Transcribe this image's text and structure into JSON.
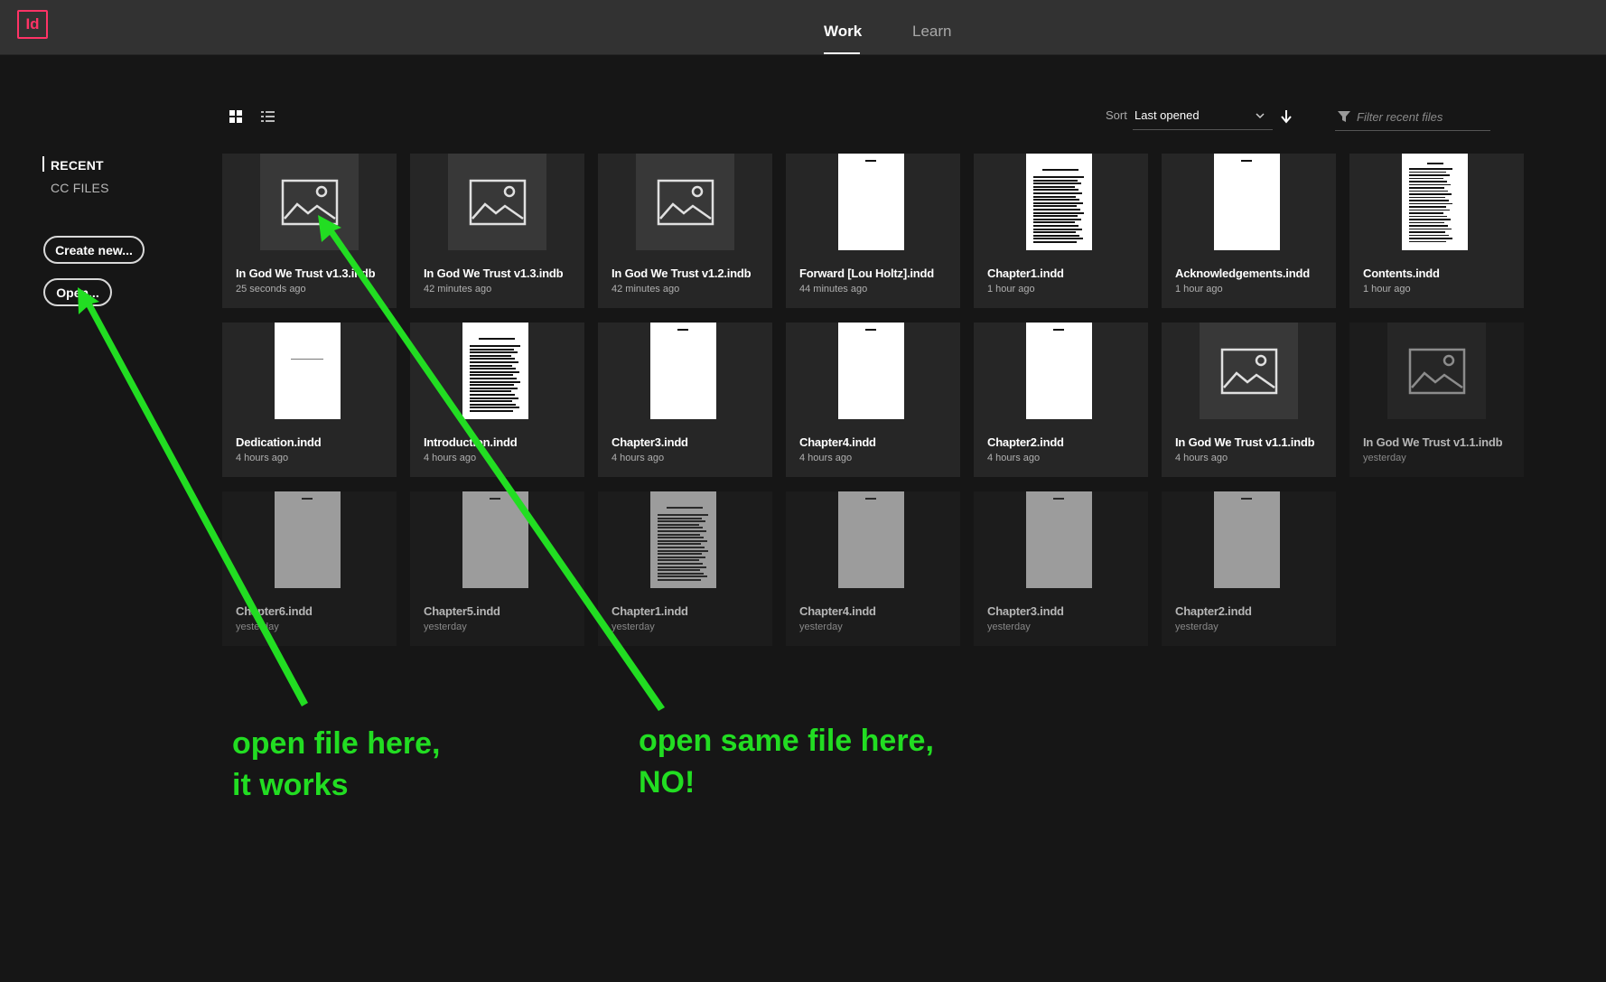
{
  "header": {
    "logo": "Id",
    "tabs": [
      {
        "label": "Work",
        "active": true
      },
      {
        "label": "Learn",
        "active": false
      }
    ]
  },
  "sidebar": {
    "items": [
      {
        "label": "RECENT",
        "active": true
      },
      {
        "label": "CC FILES",
        "active": false
      }
    ],
    "create_button": "Create new...",
    "open_button": "Open..."
  },
  "toolbar": {
    "sort_label": "Sort",
    "sort_value": "Last opened",
    "sort_direction": "descending",
    "filter_placeholder": "Filter recent files",
    "view_mode": "grid"
  },
  "files": [
    {
      "name": "In God We Trust v1.3.indb",
      "time": "25 seconds ago",
      "thumb": "placeholder",
      "dim": false
    },
    {
      "name": "In God We Trust v1.3.indb",
      "time": "42 minutes ago",
      "thumb": "placeholder",
      "dim": false
    },
    {
      "name": "In God We Trust v1.2.indb",
      "time": "42 minutes ago",
      "thumb": "placeholder",
      "dim": false
    },
    {
      "name": "Forward [Lou Holtz].indd",
      "time": "44 minutes ago",
      "thumb": "blank",
      "dim": false
    },
    {
      "name": "Chapter1.indd",
      "time": "1 hour ago",
      "thumb": "text",
      "dim": false
    },
    {
      "name": "Acknowledgements.indd",
      "time": "1 hour ago",
      "thumb": "blank",
      "dim": false
    },
    {
      "name": "Contents.indd",
      "time": "1 hour ago",
      "thumb": "toc",
      "dim": false
    },
    {
      "name": "Dedication.indd",
      "time": "4 hours ago",
      "thumb": "line",
      "dim": false
    },
    {
      "name": "Introduction.indd",
      "time": "4 hours ago",
      "thumb": "text",
      "dim": false
    },
    {
      "name": "Chapter3.indd",
      "time": "4 hours ago",
      "thumb": "blank",
      "dim": false
    },
    {
      "name": "Chapter4.indd",
      "time": "4 hours ago",
      "thumb": "blank",
      "dim": false
    },
    {
      "name": "Chapter2.indd",
      "time": "4 hours ago",
      "thumb": "blank",
      "dim": false
    },
    {
      "name": "In God We Trust v1.1.indb",
      "time": "4 hours ago",
      "thumb": "placeholder",
      "dim": false
    },
    {
      "name": "In God We Trust v1.1.indb",
      "time": "yesterday",
      "thumb": "placeholder",
      "dim": true
    },
    {
      "name": "Chapter6.indd",
      "time": "yesterday",
      "thumb": "blank",
      "dim": true
    },
    {
      "name": "Chapter5.indd",
      "time": "yesterday",
      "thumb": "blank",
      "dim": true
    },
    {
      "name": "Chapter1.indd",
      "time": "yesterday",
      "thumb": "text",
      "dim": true
    },
    {
      "name": "Chapter4.indd",
      "time": "yesterday",
      "thumb": "blank",
      "dim": true
    },
    {
      "name": "Chapter3.indd",
      "time": "yesterday",
      "thumb": "blank",
      "dim": true
    },
    {
      "name": "Chapter2.indd",
      "time": "yesterday",
      "thumb": "blank",
      "dim": true
    }
  ],
  "annotations": {
    "left_line1": "open file here,",
    "left_line2": "it works",
    "right_line1": "open same file here,",
    "right_line2": "NO!",
    "color": "#22dd22"
  },
  "colors": {
    "accent_indesign": "#ff3366",
    "background": "#161616",
    "topbar": "#323232",
    "card": "#262626"
  }
}
